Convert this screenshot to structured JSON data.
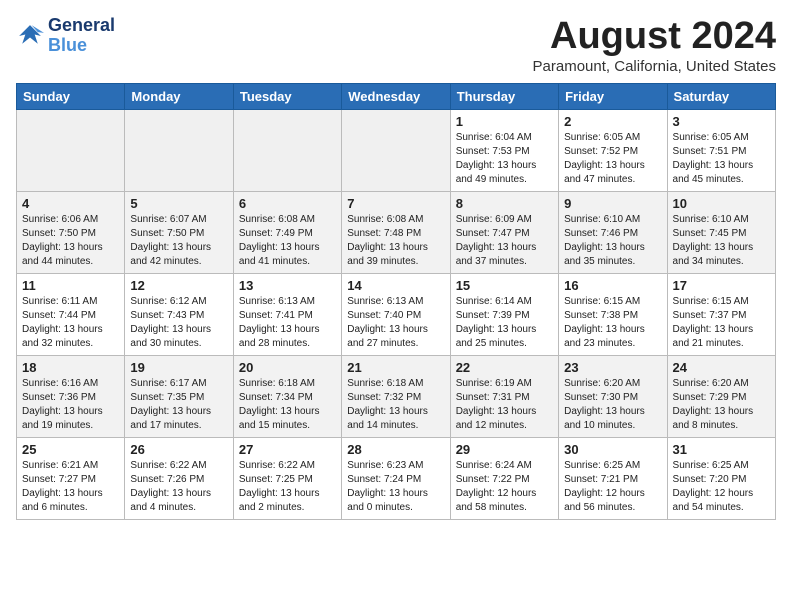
{
  "header": {
    "logo_line1": "General",
    "logo_line2": "Blue",
    "month_title": "August 2024",
    "location": "Paramount, California, United States"
  },
  "weekdays": [
    "Sunday",
    "Monday",
    "Tuesday",
    "Wednesday",
    "Thursday",
    "Friday",
    "Saturday"
  ],
  "weeks": [
    [
      {
        "day": "",
        "info": ""
      },
      {
        "day": "",
        "info": ""
      },
      {
        "day": "",
        "info": ""
      },
      {
        "day": "",
        "info": ""
      },
      {
        "day": "1",
        "info": "Sunrise: 6:04 AM\nSunset: 7:53 PM\nDaylight: 13 hours\nand 49 minutes."
      },
      {
        "day": "2",
        "info": "Sunrise: 6:05 AM\nSunset: 7:52 PM\nDaylight: 13 hours\nand 47 minutes."
      },
      {
        "day": "3",
        "info": "Sunrise: 6:05 AM\nSunset: 7:51 PM\nDaylight: 13 hours\nand 45 minutes."
      }
    ],
    [
      {
        "day": "4",
        "info": "Sunrise: 6:06 AM\nSunset: 7:50 PM\nDaylight: 13 hours\nand 44 minutes."
      },
      {
        "day": "5",
        "info": "Sunrise: 6:07 AM\nSunset: 7:50 PM\nDaylight: 13 hours\nand 42 minutes."
      },
      {
        "day": "6",
        "info": "Sunrise: 6:08 AM\nSunset: 7:49 PM\nDaylight: 13 hours\nand 41 minutes."
      },
      {
        "day": "7",
        "info": "Sunrise: 6:08 AM\nSunset: 7:48 PM\nDaylight: 13 hours\nand 39 minutes."
      },
      {
        "day": "8",
        "info": "Sunrise: 6:09 AM\nSunset: 7:47 PM\nDaylight: 13 hours\nand 37 minutes."
      },
      {
        "day": "9",
        "info": "Sunrise: 6:10 AM\nSunset: 7:46 PM\nDaylight: 13 hours\nand 35 minutes."
      },
      {
        "day": "10",
        "info": "Sunrise: 6:10 AM\nSunset: 7:45 PM\nDaylight: 13 hours\nand 34 minutes."
      }
    ],
    [
      {
        "day": "11",
        "info": "Sunrise: 6:11 AM\nSunset: 7:44 PM\nDaylight: 13 hours\nand 32 minutes."
      },
      {
        "day": "12",
        "info": "Sunrise: 6:12 AM\nSunset: 7:43 PM\nDaylight: 13 hours\nand 30 minutes."
      },
      {
        "day": "13",
        "info": "Sunrise: 6:13 AM\nSunset: 7:41 PM\nDaylight: 13 hours\nand 28 minutes."
      },
      {
        "day": "14",
        "info": "Sunrise: 6:13 AM\nSunset: 7:40 PM\nDaylight: 13 hours\nand 27 minutes."
      },
      {
        "day": "15",
        "info": "Sunrise: 6:14 AM\nSunset: 7:39 PM\nDaylight: 13 hours\nand 25 minutes."
      },
      {
        "day": "16",
        "info": "Sunrise: 6:15 AM\nSunset: 7:38 PM\nDaylight: 13 hours\nand 23 minutes."
      },
      {
        "day": "17",
        "info": "Sunrise: 6:15 AM\nSunset: 7:37 PM\nDaylight: 13 hours\nand 21 minutes."
      }
    ],
    [
      {
        "day": "18",
        "info": "Sunrise: 6:16 AM\nSunset: 7:36 PM\nDaylight: 13 hours\nand 19 minutes."
      },
      {
        "day": "19",
        "info": "Sunrise: 6:17 AM\nSunset: 7:35 PM\nDaylight: 13 hours\nand 17 minutes."
      },
      {
        "day": "20",
        "info": "Sunrise: 6:18 AM\nSunset: 7:34 PM\nDaylight: 13 hours\nand 15 minutes."
      },
      {
        "day": "21",
        "info": "Sunrise: 6:18 AM\nSunset: 7:32 PM\nDaylight: 13 hours\nand 14 minutes."
      },
      {
        "day": "22",
        "info": "Sunrise: 6:19 AM\nSunset: 7:31 PM\nDaylight: 13 hours\nand 12 minutes."
      },
      {
        "day": "23",
        "info": "Sunrise: 6:20 AM\nSunset: 7:30 PM\nDaylight: 13 hours\nand 10 minutes."
      },
      {
        "day": "24",
        "info": "Sunrise: 6:20 AM\nSunset: 7:29 PM\nDaylight: 13 hours\nand 8 minutes."
      }
    ],
    [
      {
        "day": "25",
        "info": "Sunrise: 6:21 AM\nSunset: 7:27 PM\nDaylight: 13 hours\nand 6 minutes."
      },
      {
        "day": "26",
        "info": "Sunrise: 6:22 AM\nSunset: 7:26 PM\nDaylight: 13 hours\nand 4 minutes."
      },
      {
        "day": "27",
        "info": "Sunrise: 6:22 AM\nSunset: 7:25 PM\nDaylight: 13 hours\nand 2 minutes."
      },
      {
        "day": "28",
        "info": "Sunrise: 6:23 AM\nSunset: 7:24 PM\nDaylight: 13 hours\nand 0 minutes."
      },
      {
        "day": "29",
        "info": "Sunrise: 6:24 AM\nSunset: 7:22 PM\nDaylight: 12 hours\nand 58 minutes."
      },
      {
        "day": "30",
        "info": "Sunrise: 6:25 AM\nSunset: 7:21 PM\nDaylight: 12 hours\nand 56 minutes."
      },
      {
        "day": "31",
        "info": "Sunrise: 6:25 AM\nSunset: 7:20 PM\nDaylight: 12 hours\nand 54 minutes."
      }
    ]
  ]
}
